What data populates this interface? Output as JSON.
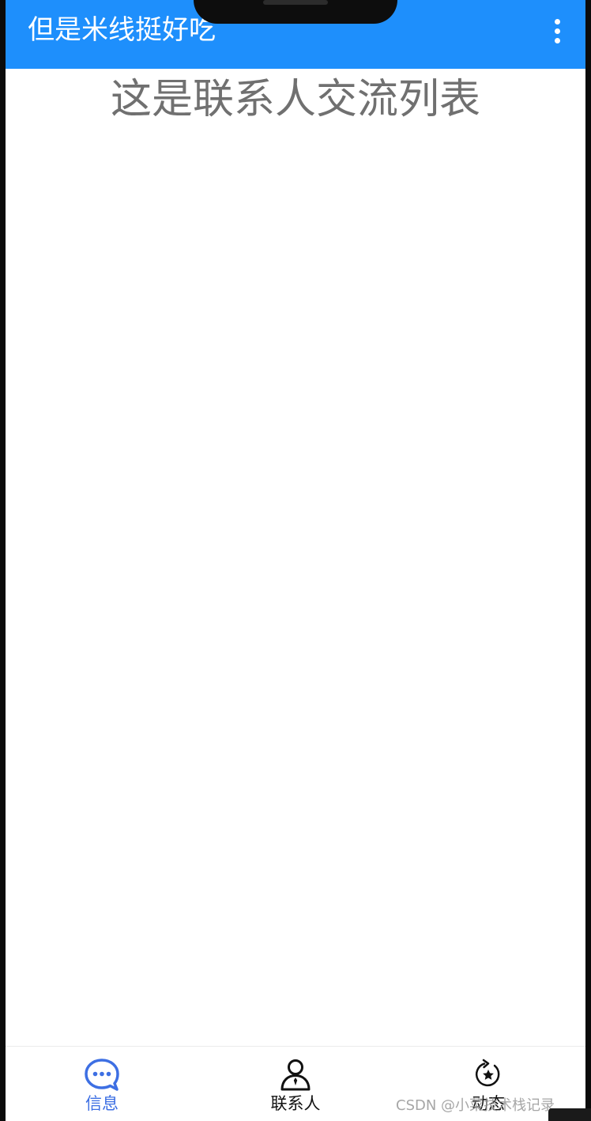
{
  "appbar": {
    "title": "但是米线挺好吃",
    "background_color": "#1e8ffc",
    "menu_icon": "more-vertical-icon"
  },
  "main": {
    "text": "这是联系人交流列表",
    "text_color": "#707070"
  },
  "bottom_nav": {
    "items": [
      {
        "label": "信息",
        "icon": "chat-bubble-icon",
        "active": true,
        "color": "#3d6fe3"
      },
      {
        "label": "联系人",
        "icon": "person-icon",
        "active": false,
        "color": "#111111"
      },
      {
        "label": "动态",
        "icon": "star-refresh-icon",
        "active": false,
        "color": "#111111"
      }
    ]
  },
  "watermark": "CSDN @小菜技术栈记录"
}
